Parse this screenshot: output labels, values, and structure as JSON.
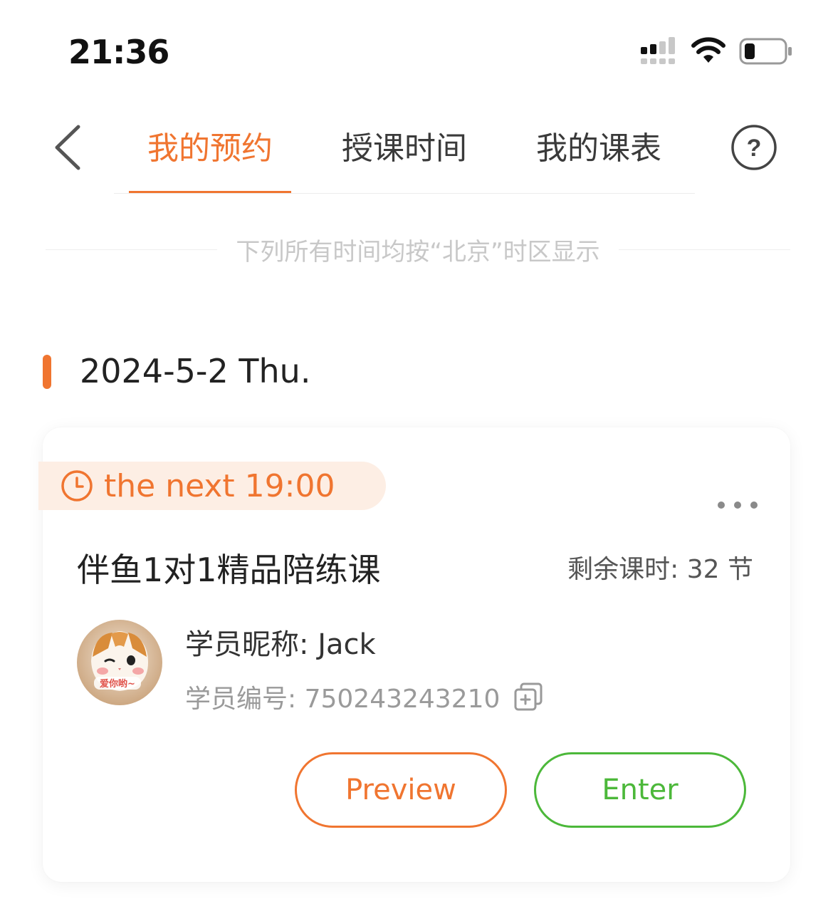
{
  "status_bar": {
    "time": "21:36"
  },
  "nav": {
    "tabs": [
      {
        "label": "我的预约",
        "active": true
      },
      {
        "label": "授课时间",
        "active": false
      },
      {
        "label": "我的课表",
        "active": false
      }
    ],
    "help_label": "?"
  },
  "timezone_note": "下列所有时间均按“北京”时区显示",
  "date_heading": "2024-5-2 Thu.",
  "card": {
    "time_label": "the next 19:00",
    "course_title": "伴鱼1对1精品陪练课",
    "remaining": "剩余课时: 32 节",
    "student_nick": "学员昵称: Jack",
    "student_id": "学员编号: 750243243210",
    "avatar_caption": "爱你哟~",
    "preview_label": "Preview",
    "enter_label": "Enter"
  },
  "colors": {
    "accent": "#f07530",
    "enter": "#4cb83a",
    "pill_bg": "#fdeee4"
  }
}
